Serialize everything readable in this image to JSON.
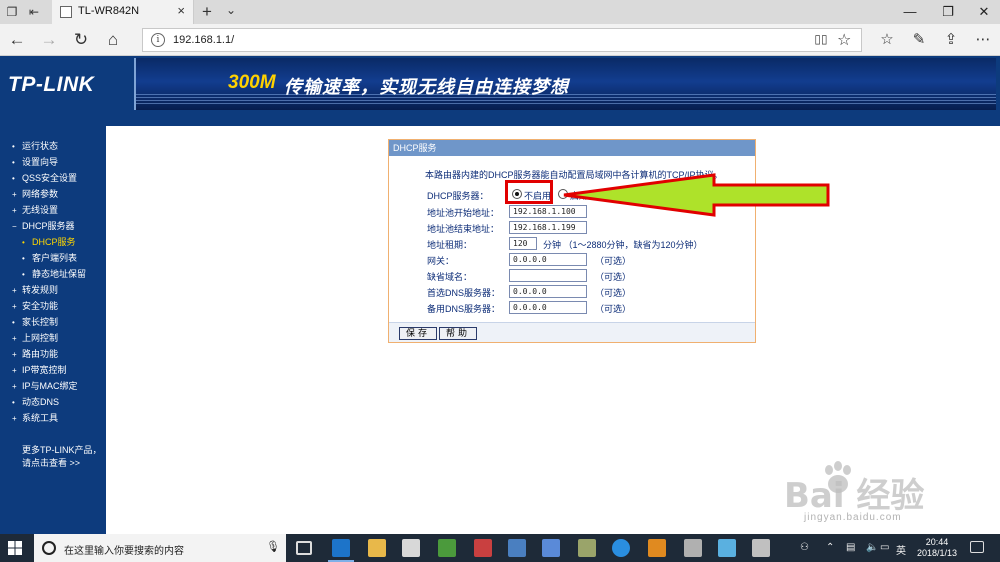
{
  "browser": {
    "tab_title": "TL-WR842N",
    "url": "192.168.1.1/"
  },
  "banner": {
    "logo": "TP-LINK",
    "slogan_speed": "300M",
    "slogan_rest": "传输速率，实现无线自由连接梦想"
  },
  "sidebar": {
    "items": [
      {
        "label": "运行状态",
        "bullet": "•",
        "level": 0
      },
      {
        "label": "设置向导",
        "bullet": "•",
        "level": 0
      },
      {
        "label": "QSS安全设置",
        "bullet": "•",
        "level": 0
      },
      {
        "label": "网络参数",
        "bullet": "+",
        "level": 0
      },
      {
        "label": "无线设置",
        "bullet": "+",
        "level": 0
      },
      {
        "label": "DHCP服务器",
        "bullet": "−",
        "level": 0
      },
      {
        "label": "DHCP服务",
        "bullet": "•",
        "level": 1,
        "active": true
      },
      {
        "label": "客户端列表",
        "bullet": "•",
        "level": 1
      },
      {
        "label": "静态地址保留",
        "bullet": "•",
        "level": 1
      },
      {
        "label": "转发规则",
        "bullet": "+",
        "level": 0
      },
      {
        "label": "安全功能",
        "bullet": "+",
        "level": 0
      },
      {
        "label": "家长控制",
        "bullet": "•",
        "level": 0
      },
      {
        "label": "上网控制",
        "bullet": "+",
        "level": 0
      },
      {
        "label": "路由功能",
        "bullet": "+",
        "level": 0
      },
      {
        "label": "IP带宽控制",
        "bullet": "+",
        "level": 0
      },
      {
        "label": "IP与MAC绑定",
        "bullet": "+",
        "level": 0
      },
      {
        "label": "动态DNS",
        "bullet": "•",
        "level": 0
      },
      {
        "label": "系统工具",
        "bullet": "+",
        "level": 0
      }
    ],
    "more_line1": "更多TP-LINK产品，",
    "more_line2": "请点击查看 >>"
  },
  "dhcp": {
    "header": "DHCP服务",
    "intro": "本路由器内建的DHCP服务器能自动配置局域网中各计算机的TCP/IP协议。",
    "server_label": "DHCP服务器：",
    "option_disable": "不启用",
    "option_enable": "启用",
    "selected": "不启用",
    "start_label": "地址池开始地址：",
    "start_value": "192.168.1.100",
    "end_label": "地址池结束地址：",
    "end_value": "192.168.1.199",
    "lease_label": "地址租期：",
    "lease_value": "120",
    "lease_hint": "分钟 （1～2880分钟，缺省为120分钟）",
    "gateway_label": "网关：",
    "gateway_value": "0.0.0.0",
    "domain_label": "缺省域名：",
    "domain_value": "",
    "dns1_label": "首选DNS服务器：",
    "dns1_value": "0.0.0.0",
    "dns2_label": "备用DNS服务器：",
    "dns2_value": "0.0.0.0",
    "optional": "（可选）",
    "save": "保存",
    "help": "帮助"
  },
  "watermark": {
    "brand": "Bai 经验",
    "url": "jingyan.baidu.com"
  },
  "taskbar": {
    "search_placeholder": "在这里输入你要搜索的内容",
    "ime": "英",
    "time": "20:44",
    "date": "2018/1/13"
  },
  "colors": {
    "router_blue": "#0d3b7d",
    "panel_header": "#6f96c9",
    "highlight_red": "#e10000",
    "arrow_green": "#aee22a"
  }
}
